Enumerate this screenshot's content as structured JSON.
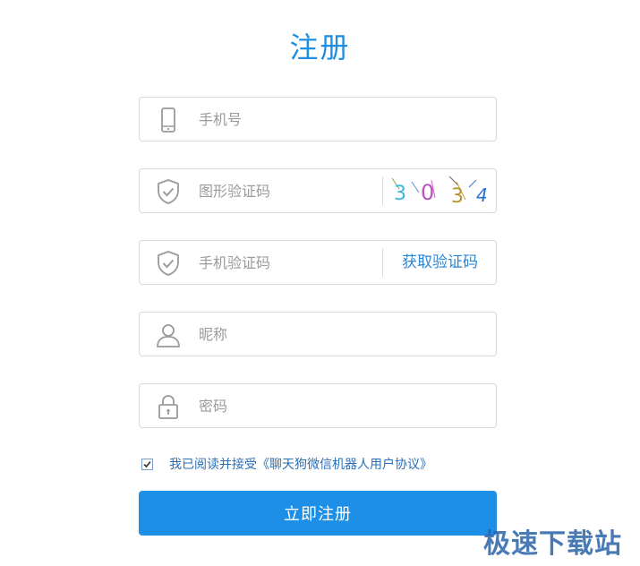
{
  "page": {
    "title": "注册"
  },
  "form": {
    "phone": {
      "placeholder": "手机号",
      "value": ""
    },
    "image_code": {
      "placeholder": "图形验证码",
      "value": "",
      "captcha_text": [
        "3",
        "0",
        "3",
        "4"
      ]
    },
    "sms_code": {
      "placeholder": "手机验证码",
      "value": "",
      "get_code_label": "获取验证码"
    },
    "nickname": {
      "placeholder": "昵称",
      "value": ""
    },
    "password": {
      "placeholder": "密码",
      "value": ""
    }
  },
  "agreement": {
    "checked": true,
    "text": "我已阅读并接受《聊天狗微信机器人用户协议》"
  },
  "submit": {
    "label": "立即注册"
  },
  "watermark": {
    "text": "极速下载站"
  },
  "colors": {
    "accent": "#1e8fe6",
    "title": "#1e8fe0",
    "link": "#2b86d6",
    "border": "#d9d9d9",
    "icon": "#9a9a9a"
  },
  "icons": {
    "phone": "mobile-phone-icon",
    "image_code": "shield-check-icon",
    "sms_code": "shield-check-icon",
    "nickname": "user-icon",
    "password": "lock-icon"
  }
}
